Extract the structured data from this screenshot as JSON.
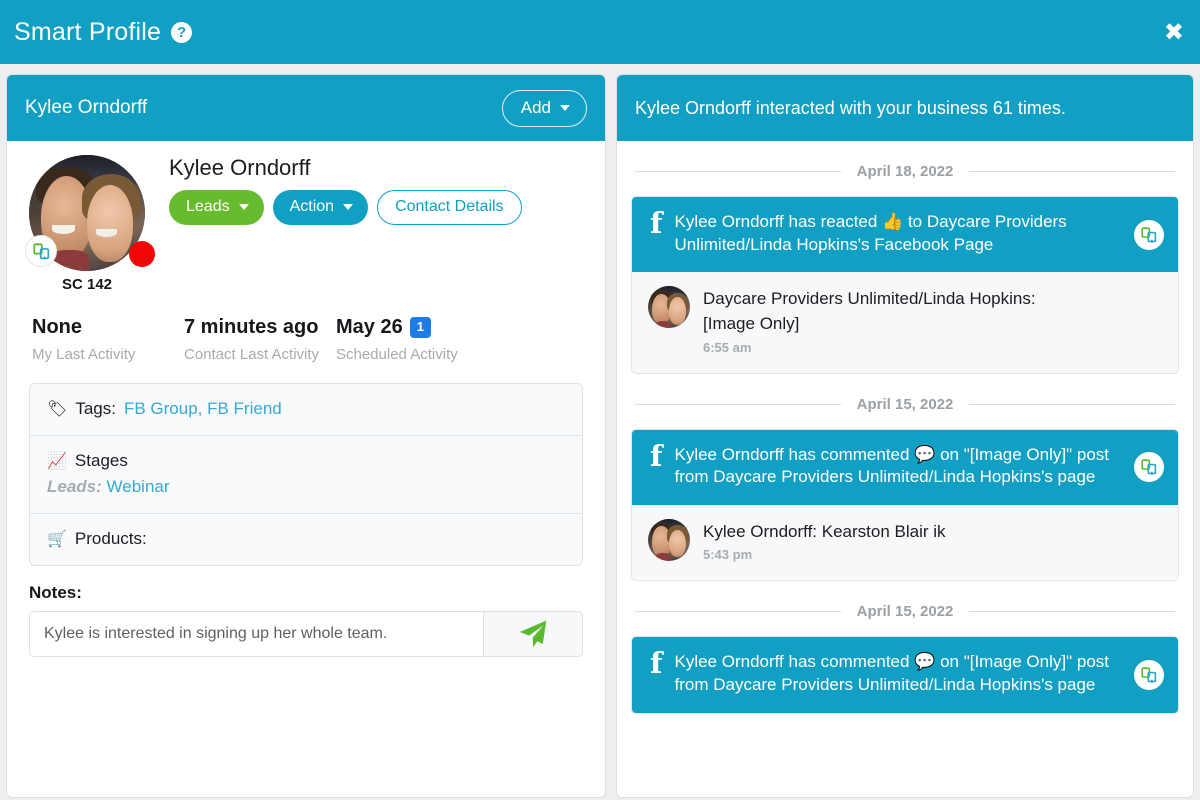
{
  "window": {
    "title": "Smart Profile",
    "help_icon": "help-circle-icon",
    "close_icon": "close-icon",
    "accent_color": "#11a0c4"
  },
  "left_panel": {
    "header": {
      "title": "Kylee Orndorff",
      "add_label": "Add"
    },
    "profile": {
      "avatar_caption": "SC 142",
      "name": "Kylee Orndorff",
      "clone_icon": "clone-icon",
      "status_dot_color": "#f40505",
      "buttons": [
        {
          "label": "Leads",
          "style": "green",
          "caret": true
        },
        {
          "label": "Action",
          "style": "blue",
          "caret": true
        },
        {
          "label": "Contact Details",
          "style": "ghost",
          "caret": false
        }
      ]
    },
    "stats": [
      {
        "value": "None",
        "label": "My Last Activity",
        "badge": ""
      },
      {
        "value": "7 minutes ago",
        "label": "Contact Last Activity",
        "badge": ""
      },
      {
        "value": "May 26",
        "label": "Scheduled Activity",
        "badge": "1"
      }
    ],
    "info": {
      "tags_label": "Tags:",
      "tags_value": "FB Group, FB Friend",
      "tags_icon": "tag-icon",
      "stages_label": "Stages",
      "stages_icon": "chart-line-icon",
      "stage_group": "Leads:",
      "stage_value": "Webinar",
      "products_label": "Products:",
      "products_icon": "basket-icon"
    },
    "notes": {
      "title": "Notes:",
      "value": "Kylee is interested in signing up her whole team.",
      "placeholder": "Notes",
      "send_icon": "send-paper-plane-icon"
    }
  },
  "right_panel": {
    "header": {
      "title": "Kylee Orndorff interacted with your business 61 times.",
      "interaction_count": "61"
    },
    "timeline": [
      {
        "date": "April 18, 2022",
        "source_icon": "facebook-icon",
        "head_text_parts": [
          "Kylee Orndorff has reacted ",
          "👍",
          " to Daycare Providers Unlimited/Linda Hopkins's Facebook Page"
        ],
        "head_text": "Kylee Orndorff has reacted 👍 to Daycare Providers Unlimited/Linda Hopkins's Facebook Page",
        "badge_icon": "clone-icon",
        "body_line1": "Daycare Providers Unlimited/Linda Hopkins:",
        "body_line2": "[Image Only]",
        "time": "6:55 am"
      },
      {
        "date": "April 15, 2022",
        "source_icon": "facebook-icon",
        "head_text_parts": [
          "Kylee Orndorff has commented ",
          "💬",
          " on \"[Image Only]\" post from Daycare Providers Unlimited/Linda Hopkins's page"
        ],
        "head_text": "Kylee Orndorff has commented 💬 on \"[Image Only]\" post from Daycare Providers Unlimited/Linda Hopkins's page",
        "badge_icon": "clone-icon",
        "body_line1": "Kylee Orndorff: Kearston Blair ik",
        "body_line2": "",
        "time": "5:43 pm"
      },
      {
        "date": "April 15, 2022",
        "source_icon": "facebook-icon",
        "head_text_parts": [
          "Kylee Orndorff has commented ",
          "💬",
          " on \"[Image Only]\" post from Daycare Providers Unlimited/Linda Hopkins's page"
        ],
        "head_text": "Kylee Orndorff has commented 💬 on \"[Image Only]\" post from Daycare Providers Unlimited/Linda Hopkins's page",
        "badge_icon": "clone-icon",
        "body_line1": "",
        "body_line2": "",
        "time": ""
      }
    ]
  }
}
